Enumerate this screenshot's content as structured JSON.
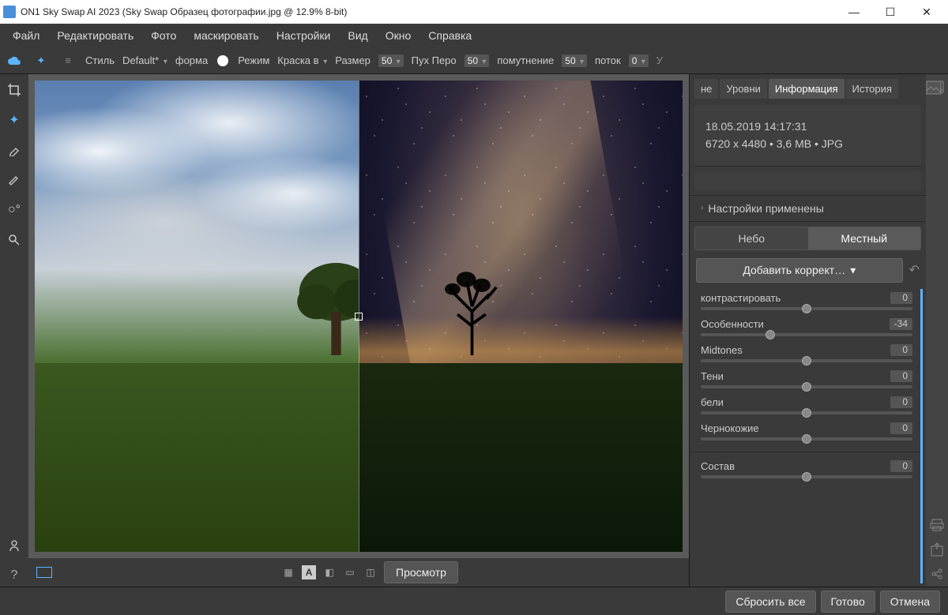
{
  "title": "ON1 Sky Swap AI 2023 (Sky Swap Образец фотографии.jpg @ 12.9% 8-bit)",
  "menu": [
    "Файл",
    "Редактировать",
    "Фото",
    "маскировать",
    "Настройки",
    "Вид",
    "Окно",
    "Справка"
  ],
  "opts": {
    "style_label": "Стиль",
    "style_value": "Default*",
    "shape_label": "форма",
    "mode_label": "Режим",
    "mode_value": "Краска в",
    "size_label": "Размер",
    "size_value": "50",
    "feather_label": "Пух Перо",
    "feather_value": "50",
    "opacity_label": "помутнение",
    "opacity_value": "50",
    "flow_label": "поток",
    "flow_value": "0"
  },
  "canvasbar": {
    "preview": "Просмотр"
  },
  "tabs": [
    "не",
    "Уровни",
    "Информация",
    "История"
  ],
  "active_tab": 2,
  "info": {
    "date": "18.05.2019 14:17:31",
    "meta": "6720 x 4480 • 3,6 MB • JPG"
  },
  "section": "Настройки применены",
  "modes": {
    "sky": "Небо",
    "local": "Местный"
  },
  "add_correction": "Добавить коррект…",
  "sliders": [
    {
      "label": "контрастировать",
      "value": 0,
      "pos": 50
    },
    {
      "label": "Особенности",
      "value": -34,
      "pos": 33
    },
    {
      "label": "Midtones",
      "value": 0,
      "pos": 50
    },
    {
      "label": "Тени",
      "value": 0,
      "pos": 50
    },
    {
      "label": "бели",
      "value": 0,
      "pos": 50
    },
    {
      "label": "Чернокожие",
      "value": 0,
      "pos": 50
    }
  ],
  "slider_group2": [
    {
      "label": "Состав",
      "value": 0,
      "pos": 50
    }
  ],
  "footer": {
    "reset": "Сбросить все",
    "done": "Готово",
    "cancel": "Отмена"
  }
}
